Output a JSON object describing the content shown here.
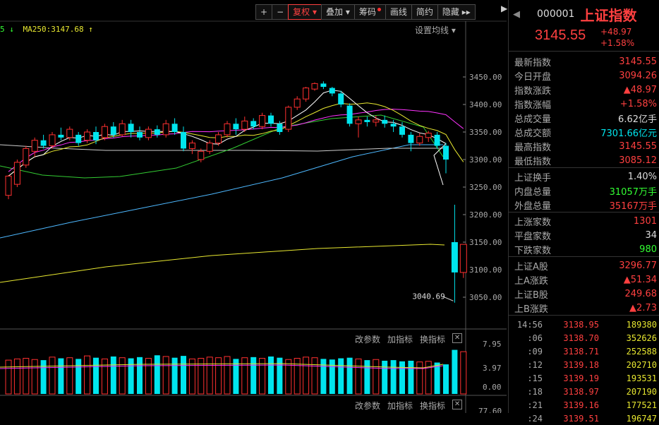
{
  "toolbar": {
    "items": [
      "+",
      "−",
      "复权",
      "叠加",
      "筹码",
      "画线",
      "简约",
      "隐藏"
    ],
    "active_index": 2,
    "dropdown": [
      false,
      false,
      true,
      true,
      false,
      false,
      false,
      false
    ],
    "more": "▸▸"
  },
  "ma_label": "MA250:3147.68",
  "settings_label": "设置均线",
  "y_axis": [
    "3450.00",
    "3400.00",
    "3350.00",
    "3300.00",
    "3250.00",
    "3200.00",
    "3150.00",
    "3100.00",
    "3050.00"
  ],
  "low_annotation": "3040.69",
  "vol_axis": [
    "7.95",
    "3.97",
    "0.00"
  ],
  "vol_axis2": "77.60",
  "sub_buttons": [
    "改参数",
    "加指标",
    "换指标"
  ],
  "colors": {
    "up": "#ff3030",
    "down": "#00e5ee",
    "yellow": "#e8e830"
  },
  "stock": {
    "code": "000001",
    "name": "上证指数",
    "price": "3145.55",
    "change": "+48.97",
    "pct": "+1.58%"
  },
  "stats": [
    {
      "label": "最新指数",
      "value": "3145.55",
      "color": "#ff4040"
    },
    {
      "label": "今日开盘",
      "value": "3094.26",
      "color": "#ff4040"
    },
    {
      "label": "指数涨跌",
      "value": "▲48.97",
      "color": "#ff4040"
    },
    {
      "label": "指数涨幅",
      "value": "+1.58%",
      "color": "#ff4040"
    },
    {
      "label": "总成交量",
      "value": "6.62亿手",
      "color": "#dddddd"
    },
    {
      "label": "总成交额",
      "value": "7301.66亿元",
      "color": "#00e5ee"
    },
    {
      "label": "最高指数",
      "value": "3145.55",
      "color": "#ff4040"
    },
    {
      "label": "最低指数",
      "value": "3085.12",
      "color": "#ff4040"
    }
  ],
  "stats2": [
    {
      "label": "上证换手",
      "value": "1.40%",
      "color": "#dddddd"
    },
    {
      "label": "内盘总量",
      "value": "31057万手",
      "color": "#33ff33"
    },
    {
      "label": "外盘总量",
      "value": "35167万手",
      "color": "#ff4040"
    }
  ],
  "stats3": [
    {
      "label": "上涨家数",
      "value": "1301",
      "color": "#ff4040"
    },
    {
      "label": "平盘家数",
      "value": "34",
      "color": "#dddddd"
    },
    {
      "label": "下跌家数",
      "value": "980",
      "color": "#33ff33"
    }
  ],
  "stats4": [
    {
      "label": "上证A股",
      "value": "3296.77",
      "color": "#ff4040"
    },
    {
      "label": "上A涨跌",
      "value": "▲51.34",
      "color": "#ff4040"
    },
    {
      "label": "上证B股",
      "value": "249.68",
      "color": "#ff4040"
    },
    {
      "label": "上B涨跌",
      "value": "▲2.73",
      "color": "#ff4040"
    }
  ],
  "ticks": [
    {
      "t": "14:56",
      "p": "3138.95",
      "v": "189380"
    },
    {
      "t": ":06",
      "p": "3138.70",
      "v": "352626"
    },
    {
      "t": ":09",
      "p": "3138.71",
      "v": "252588"
    },
    {
      "t": ":12",
      "p": "3139.18",
      "v": "202710"
    },
    {
      "t": ":15",
      "p": "3139.19",
      "v": "193531"
    },
    {
      "t": ":18",
      "p": "3138.97",
      "v": "207190"
    },
    {
      "t": ":21",
      "p": "3139.16",
      "v": "177521"
    },
    {
      "t": ":24",
      "p": "3139.51",
      "v": "196747"
    }
  ],
  "chart_data": {
    "type": "candlestick",
    "y_range": [
      3030,
      3470
    ],
    "candles": [
      [
        3235,
        3270,
        3228,
        3272
      ],
      [
        3255,
        3295,
        3250,
        3300
      ],
      [
        3290,
        3320,
        3285,
        3325
      ],
      [
        3315,
        3335,
        3305,
        3340
      ],
      [
        3335,
        3325,
        3320,
        3345
      ],
      [
        3325,
        3345,
        3320,
        3350
      ],
      [
        3345,
        3340,
        3335,
        3358
      ],
      [
        3340,
        3355,
        3335,
        3360
      ],
      [
        3345,
        3330,
        3325,
        3350
      ],
      [
        3335,
        3350,
        3330,
        3355
      ],
      [
        3350,
        3335,
        3328,
        3360
      ],
      [
        3340,
        3360,
        3335,
        3365
      ],
      [
        3360,
        3345,
        3340,
        3368
      ],
      [
        3345,
        3365,
        3342,
        3372
      ],
      [
        3365,
        3350,
        3340,
        3372
      ],
      [
        3350,
        3340,
        3335,
        3360
      ],
      [
        3340,
        3355,
        3335,
        3360
      ],
      [
        3355,
        3345,
        3340,
        3362
      ],
      [
        3345,
        3365,
        3340,
        3372
      ],
      [
        3365,
        3350,
        3345,
        3375
      ],
      [
        3350,
        3320,
        3315,
        3360
      ],
      [
        3320,
        3330,
        3310,
        3335
      ],
      [
        3300,
        3315,
        3295,
        3320
      ],
      [
        3315,
        3330,
        3310,
        3335
      ],
      [
        3330,
        3345,
        3325,
        3350
      ],
      [
        3345,
        3365,
        3340,
        3370
      ],
      [
        3365,
        3355,
        3345,
        3375
      ],
      [
        3355,
        3370,
        3350,
        3378
      ],
      [
        3370,
        3360,
        3355,
        3375
      ],
      [
        3360,
        3380,
        3355,
        3385
      ],
      [
        3380,
        3365,
        3360,
        3385
      ],
      [
        3365,
        3350,
        3345,
        3370
      ],
      [
        3355,
        3395,
        3350,
        3398
      ],
      [
        3395,
        3410,
        3390,
        3415
      ],
      [
        3410,
        3430,
        3405,
        3432
      ],
      [
        3428,
        3438,
        3425,
        3440
      ],
      [
        3438,
        3432,
        3428,
        3442
      ],
      [
        3430,
        3420,
        3415,
        3432
      ],
      [
        3420,
        3400,
        3395,
        3425
      ],
      [
        3398,
        3365,
        3360,
        3402
      ],
      [
        3365,
        3372,
        3340,
        3378
      ],
      [
        3372,
        3368,
        3360,
        3378
      ],
      [
        3368,
        3372,
        3360,
        3380
      ],
      [
        3372,
        3365,
        3358,
        3380
      ],
      [
        3365,
        3360,
        3350,
        3372
      ],
      [
        3360,
        3345,
        3340,
        3368
      ],
      [
        3345,
        3330,
        3315,
        3350
      ],
      [
        3330,
        3342,
        3325,
        3348
      ],
      [
        3340,
        3348,
        3332,
        3352
      ],
      [
        3345,
        3325,
        3320,
        3350
      ],
      [
        3325,
        3300,
        3275,
        3330
      ],
      [
        3150,
        3095,
        3040,
        3218
      ],
      [
        3095,
        3146,
        3085,
        3146
      ]
    ],
    "volumes": [
      5.6,
      5.8,
      5.9,
      5.7,
      5.6,
      6.1,
      5.9,
      6.0,
      5.8,
      6.3,
      6.0,
      5.8,
      6.2,
      6.0,
      5.9,
      6.1,
      5.9,
      6.4,
      6.2,
      6.0,
      6.3,
      5.8,
      5.9,
      6.1,
      6.0,
      6.2,
      5.8,
      6.0,
      6.1,
      5.9,
      6.2,
      6.0,
      5.7,
      5.9,
      6.1,
      6.0,
      5.8,
      5.7,
      5.9,
      6.0,
      5.8,
      5.6,
      5.7,
      5.5,
      5.6,
      5.4,
      5.5,
      5.3,
      5.4,
      5.2,
      4.9,
      7.3,
      7.0
    ]
  }
}
